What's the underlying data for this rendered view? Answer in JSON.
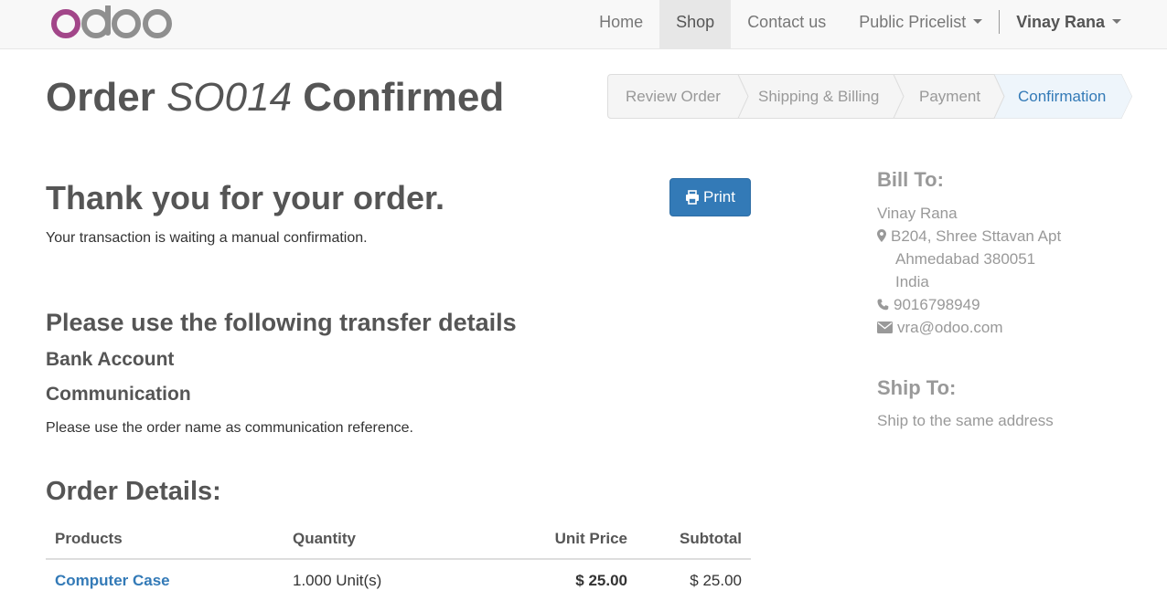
{
  "brand": {
    "logo_text": "odoo",
    "logo_o_color": "#a24689",
    "logo_letters_color": "#8f8f8f"
  },
  "navbar": {
    "items": [
      {
        "label": "Home"
      },
      {
        "label": "Shop",
        "active": true
      },
      {
        "label": "Contact us"
      },
      {
        "label": "Public Pricelist"
      }
    ],
    "user": "Vinay Rana"
  },
  "page": {
    "title_prefix": "Order",
    "order_no": "SO014",
    "title_suffix": "Confirmed"
  },
  "wizard": {
    "steps": [
      "Review Order",
      "Shipping & Billing",
      "Payment",
      "Confirmation"
    ],
    "current_step": "Confirmation"
  },
  "confirmation": {
    "thank_you": "Thank you for your order.",
    "status_text": "Your transaction is waiting a manual confirmation.",
    "print_label": "Print",
    "transfer_heading": "Please use the following transfer details",
    "bank_account_label": "Bank Account",
    "communication_label": "Communication",
    "communication_note": "Please use the order name as communication reference."
  },
  "order_details": {
    "heading": "Order Details:",
    "columns": [
      "Products",
      "Quantity",
      "Unit Price",
      "Subtotal"
    ],
    "rows": [
      {
        "product": "Computer Case",
        "quantity": "1.000 Unit(s)",
        "unit_price": "$ 25.00",
        "subtotal": "$ 25.00"
      }
    ]
  },
  "bill_to": {
    "heading": "Bill To:",
    "name": "Vinay Rana",
    "street": "B204, Shree Sttavan Apt",
    "city": "Ahmedabad 380051",
    "country": "India",
    "phone": "9016798949",
    "email": "vra@odoo.com"
  },
  "ship_to": {
    "heading": "Ship To:",
    "text": "Ship to the same address"
  },
  "colors": {
    "accent": "#337ab7",
    "muted": "#999999",
    "nav_bg": "#f8f8f8"
  }
}
